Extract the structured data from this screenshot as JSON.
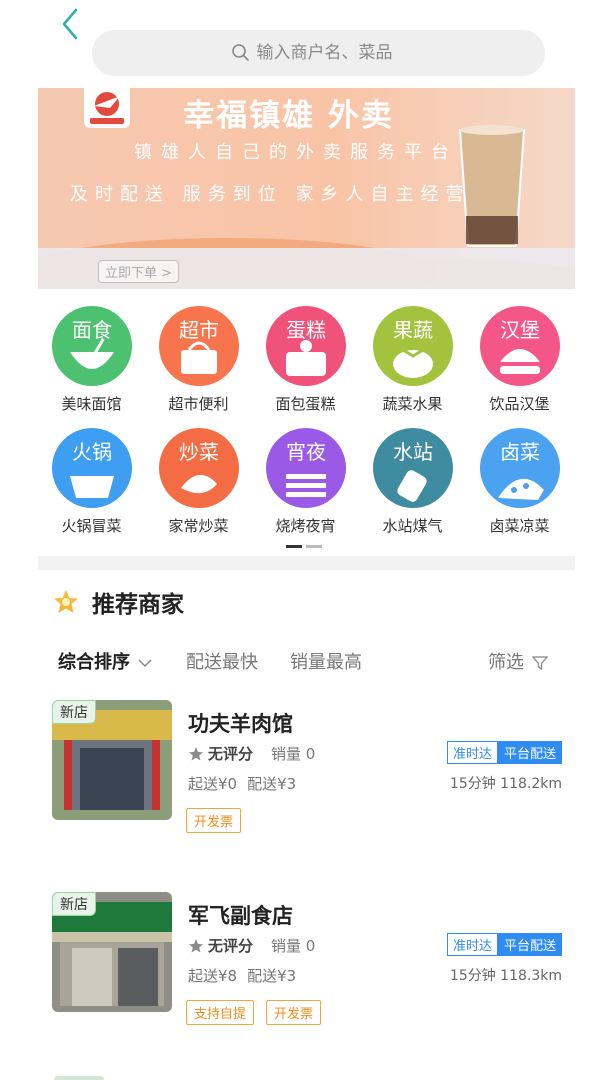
{
  "search": {
    "placeholder": "输入商户名、菜品"
  },
  "banner": {
    "title": "幸福镇雄 外卖",
    "subtitle": "镇雄人自己的外卖服务平台",
    "slogan": "及时配送  服务到位  家乡人自主经营",
    "order_button": "立即下单 >"
  },
  "categories": [
    {
      "tag": "面食",
      "label": "美味面馆",
      "color": "#4cc16f"
    },
    {
      "tag": "超市",
      "label": "超市便利",
      "color": "#f8744d"
    },
    {
      "tag": "蛋糕",
      "label": "面包蛋糕",
      "color": "#f0527a"
    },
    {
      "tag": "果蔬",
      "label": "蔬菜水果",
      "color": "#a3c23d"
    },
    {
      "tag": "汉堡",
      "label": "饮品汉堡",
      "color": "#f5568a"
    },
    {
      "tag": "火锅",
      "label": "火锅冒菜",
      "color": "#3d9ef2"
    },
    {
      "tag": "炒菜",
      "label": "家常炒菜",
      "color": "#f46c43"
    },
    {
      "tag": "宵夜",
      "label": "烧烤夜宵",
      "color": "#9a5ae6"
    },
    {
      "tag": "水站",
      "label": "水站煤气",
      "color": "#3f8ca0"
    },
    {
      "tag": "卤菜",
      "label": "卤菜凉菜",
      "color": "#4aa2f0"
    }
  ],
  "section": {
    "title": "推荐商家"
  },
  "sort": {
    "default": "综合排序",
    "fastest": "配送最快",
    "top_sales": "销量最高",
    "filter": "筛选"
  },
  "shops": [
    {
      "badge": "新店",
      "name": "功夫羊肉馆",
      "rating": "无评分",
      "sales": "销量 0",
      "min_order": "起送¥0",
      "delivery_fee": "配送¥3",
      "tag_ontime": "准时达",
      "tag_platform": "平台配送",
      "time_distance": "15分钟 118.2km",
      "extras": [
        "开发票"
      ]
    },
    {
      "badge": "新店",
      "name": "军飞副食店",
      "rating": "无评分",
      "sales": "销量 0",
      "min_order": "起送¥8",
      "delivery_fee": "配送¥3",
      "tag_ontime": "准时达",
      "tag_platform": "平台配送",
      "time_distance": "15分钟 118.3km",
      "extras": [
        "支持自提",
        "开发票"
      ]
    }
  ],
  "colors": {
    "accent": "#2f8cf3",
    "back_arrow": "#2bb3a0",
    "star": "#f6b83a",
    "invoice": "#f0901e"
  }
}
